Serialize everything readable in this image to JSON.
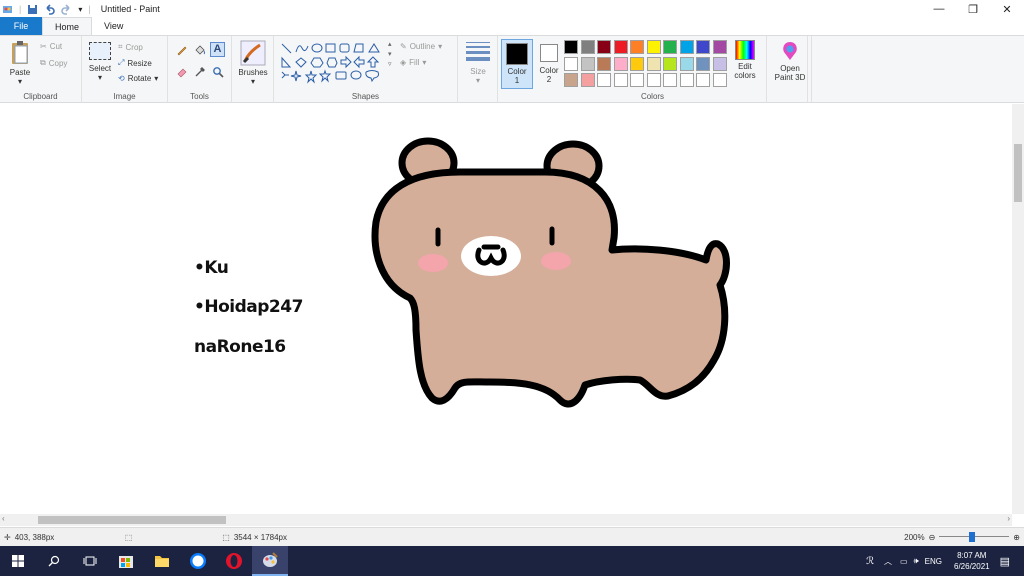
{
  "window": {
    "title": "Untitled - Paint"
  },
  "tabs": [
    {
      "label": "File"
    },
    {
      "label": "Home"
    },
    {
      "label": "View"
    }
  ],
  "clipboard": {
    "paste": "Paste",
    "cut": "Cut",
    "copy": "Copy",
    "group": "Clipboard"
  },
  "image": {
    "select": "Select",
    "crop": "Crop",
    "resize": "Resize",
    "rotate": "Rotate",
    "group": "Image"
  },
  "tools": {
    "group": "Tools"
  },
  "brushes": {
    "label": "Brushes"
  },
  "shapes": {
    "outline": "Outline",
    "fill": "Fill",
    "group": "Shapes"
  },
  "size": {
    "label": "Size"
  },
  "color1": {
    "label": "Color",
    "num": "1",
    "value": "#000000"
  },
  "color2": {
    "label": "Color",
    "num": "2",
    "value": "#ffffff"
  },
  "colors": {
    "group": "Colors",
    "row1": [
      "#000000",
      "#7f7f7f",
      "#880015",
      "#ed1c24",
      "#ff7f27",
      "#fff200",
      "#22b14c",
      "#00a2e8",
      "#3f48cc",
      "#a349a4"
    ],
    "row2": [
      "#ffffff",
      "#c3c3c3",
      "#b97a57",
      "#ffaec9",
      "#ffc90e",
      "#efe4b0",
      "#b5e61d",
      "#99d9ea",
      "#7092be",
      "#c8bfe7"
    ],
    "row3": [
      "#c8a48c",
      "#f4a0a0",
      "#ffffff",
      "#ffffff",
      "#ffffff",
      "#ffffff",
      "#ffffff",
      "#ffffff",
      "#ffffff",
      "#ffffff"
    ]
  },
  "edit_colors": {
    "line1": "Edit",
    "line2": "colors"
  },
  "paint3d": {
    "line1": "Open",
    "line2": "Paint 3D"
  },
  "canvas_text": {
    "line1": "•Ku",
    "line2": "•Hoidap247",
    "line3": "naRone16"
  },
  "status": {
    "cursor_pos": "403, 388px",
    "image_size": "3544 × 1784px",
    "zoom": "200%"
  },
  "taskbar": {
    "lang": "ENG",
    "time": "8:07 AM",
    "date": "6/26/2021"
  }
}
